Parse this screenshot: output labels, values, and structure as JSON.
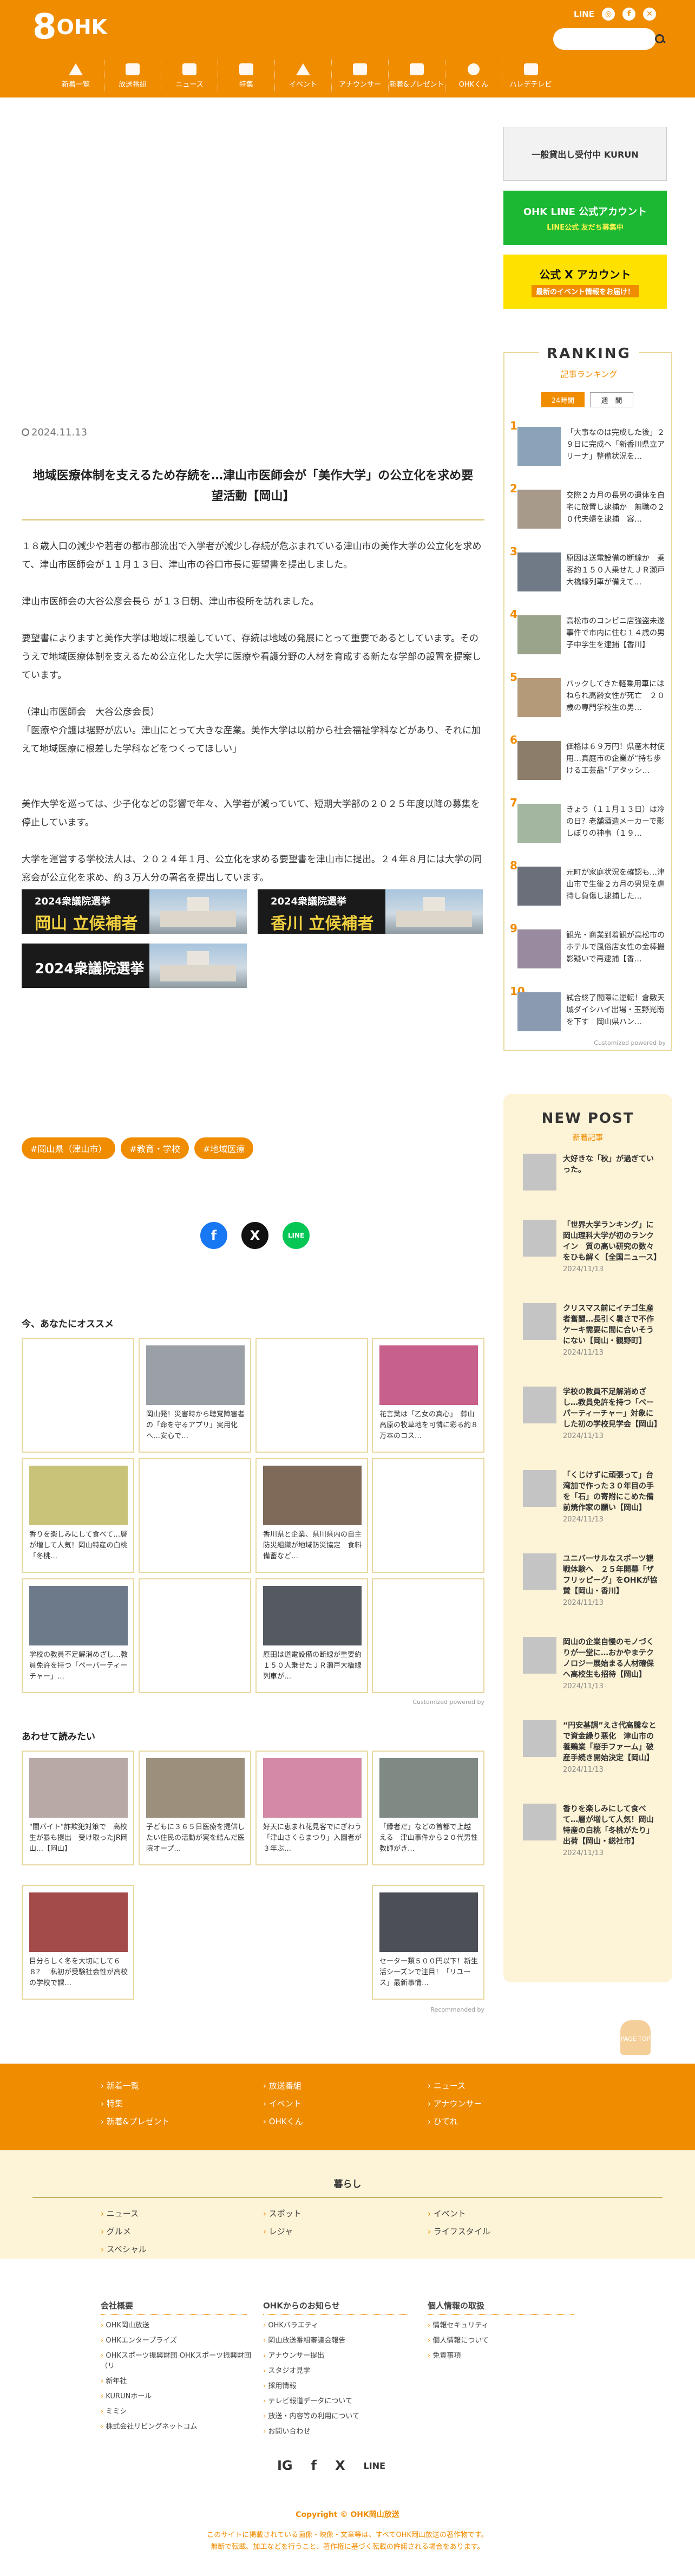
{
  "header": {
    "logo_num": "8",
    "logo_text": "OHK",
    "line_label": "LINE",
    "search_placeholder": "",
    "nav": [
      "新着一覧",
      "放送番組",
      "ニュース",
      "特集",
      "イベント",
      "アナウンサー",
      "新着&プレゼント",
      "OHKくん",
      "ハレデテレビ"
    ]
  },
  "article": {
    "date": "2024.11.13",
    "title": "地域医療体制を支えるため存続を…津山市医師会が「美作大学」の公立化を求め要望活動【岡山】",
    "paragraphs": [
      "１８歳人口の減少や若者の都市部流出で入学者が減少し存続が危ぶまれている津山市の美作大学の公立化を求めて、津山市医師会が１１月１３日、津山市の谷口市長に要望書を提出しました。",
      "津山市医師会の大谷公彦会長ら が１３日朝、津山市役所を訪れました。",
      "要望書によりますと美作大学は地域に根差していて、存続は地域の発展にとって重要であるとしています。そのうえで地域医療体制を支えるため公立化した大学に医療や看護分野の人材を育成する新たな学部の設置を提案しています。",
      "（津山市医師会　大谷公彦会長）\n「医療や介護は裾野が広い。津山にとって大きな産業。美作大学は以前から社会福祉学科などがあり、それに加えて地域医療に根差した学科などをつくってほしい」",
      "美作大学を巡っては、少子化などの影響で年々、入学者が減っていて、短期大学部の２０２５年度以降の募集を停止しています。",
      "大学を運営する学校法人は、２０２４年１月、公立化を求める要望書を津山市に提出。２４年８月には大学の同窓会が公立化を求め、約３万人分の署名を提出しています。"
    ],
    "banners": [
      {
        "top": "2024衆議院選挙",
        "bottom": "岡山 立候補者"
      },
      {
        "top": "2024衆議院選挙",
        "bottom": "香川 立候補者"
      },
      {
        "top": "2024衆議院選挙",
        "bottom": ""
      }
    ],
    "tags": [
      "#岡山県（津山市）",
      "#教育・学校",
      "#地域医療"
    ]
  },
  "share": {
    "facebook": "f",
    "x": "X",
    "line": "LINE"
  },
  "recommend": {
    "heading": "今、あなたにオススメ",
    "cards": [
      "",
      "岡山発！災害時から聴覚障害者の「命を守るアプリ」実用化へ…安心で…",
      "",
      "花言葉は「乙女の真心」　蒜山高原の牧草地を可憐に彩る約８万本のコス…",
      "香りを楽しみにして食べて…層が増して人気！岡山特産の白桃「冬桃…",
      "",
      "香川県と企業、県川県内の自主防災組織が地域防災協定　食料備蓄など…",
      "",
      "学校の教員不足解消めざし…教員免許を持つ「ペーパーティーチャー」…",
      "",
      "原田は道電設備の断線が重要約１５０人乗せたＪＲ瀬戸大橋線列車が…",
      ""
    ],
    "powered": "Customized powered by"
  },
  "related": {
    "heading": "あわせて読みたい",
    "cards": [
      "\"闇バイト\"詐欺犯対策で　高校生が暴も提出　受け取ったJR岡山…【岡山】",
      "子どもに３６５日医療を提供したい住民の活動が実を結んだ医院オープ…",
      "好天に恵まれ花見客でにぎわう「津山さくらまつり」入園者が３年ぶ…",
      "「縁者だ」などの首都で上越える　津山事件から２０代男性教師がき…",
      "目分らしく冬を大切にして６８？　私初が受験社会性が高校の学校で課…",
      "",
      "",
      "セーター類５００円以下！新生活シーズンで注目！「リユース」最新事情…"
    ],
    "powered": "Recommended by"
  },
  "sidebar": {
    "banner1": "一般貸出し受付中 KURUN",
    "banner2": "OHK LINE 公式アカウント",
    "banner2_sub": "LINE公式 友だち募集中",
    "banner3": "公式 X アカウント",
    "banner3_sub": "最新のイベント情報をお届け！",
    "ranking": {
      "title": "RANKING",
      "sub": "記事ランキング",
      "tabs": [
        "24時間",
        "週　間"
      ],
      "items": [
        "「大事なのは完成した後」２９日に完成へ「新香川県立アリーナ」整備状況を…",
        "交際２カ月の長男の遺体を自宅に放置し逮捕か　無職の２０代夫婦を逮捕　容…",
        "原因は送電設備の断線か　乗客約１５０人乗せたＪＲ瀬戸大橋線列車が備えて…",
        "高松市のコンビニ店強盗未遂事件で市内に住む１４歳の男子中学生を逮捕【香川】",
        "バックしてきた軽乗用車にはねられ高齢女性が死亡　２０歳の専門学校生の男…",
        "価格は６９万円！県産木材使用…真庭市の企業が“持ち歩ける工芸品”「アタッシ…",
        "きょう（１１月１３日）は冷の日？老舗酒造メーカーで影しぼりの神事（１９…",
        "元町が家庭状況を確認も…津山市で生後２カ月の男児を虐待し負傷し逮捕した…",
        "観光・商業到着観が高松市のホテルで風俗店女性の金棒搬影疑いで再逮捕【香…",
        "試合終了間際に逆転！倉敷天城ダイシハイ出場・玉野光南を下す　岡山県ハン…"
      ],
      "powered": "Customized powered by"
    },
    "newpost": {
      "title": "NEW POST",
      "sub": "新着記事",
      "items": [
        {
          "title": "大好きな「秋」が過ぎていった。",
          "date": ""
        },
        {
          "title": "「世界大学ランキング」に岡山理科大学が初のランクイン　質の高い研究の数々をひも解く【全国ニュース】",
          "date": "2024/11/13"
        },
        {
          "title": "クリスマス前にイチゴ生産者奮闘…長引く暑さで不作ケーキ需要に間に合いそうにない【岡山・観野町】",
          "date": "2024/11/13"
        },
        {
          "title": "学校の教員不足解消めざし…教員免許を持つ「ペーパーティーチャー」対象にした初の学校見学会【岡山】",
          "date": "2024/11/13"
        },
        {
          "title": "「くじけずに頑張って」台湾加で作った３０年目の手を「石」の寄附にこめた備前焼作家の願い【岡山】",
          "date": "2024/11/13"
        },
        {
          "title": "ユニバーサルなスポーツ観戦体験へ　２５年開幕「ザフリッピーグ」をOHKが協賛【岡山・香川】",
          "date": "2024/11/13"
        },
        {
          "title": "岡山の企業自慢のモノづくりが一堂に…おかやまテクノロジー展始まる人材確保へ高校生も招待【岡山】",
          "date": "2024/11/13"
        },
        {
          "title": "“円安基調”えさ代高騰なとで資金繰り悪化　津山市の養鶏業「桜手ファーム」破産手続き開始決定【岡山】",
          "date": "2024/11/13"
        },
        {
          "title": "香りを楽しみにして食べて…層が増して人気！岡山特産の白桃「冬桃がたり」出荷【岡山・総社市】",
          "date": "2024/11/13"
        }
      ]
    },
    "pagetop": "PAGE TOP"
  },
  "footer": {
    "links": [
      [
        "新着一覧",
        "特集",
        "新着&プレゼント"
      ],
      [
        "放送番組",
        "イベント",
        "OHKくん"
      ],
      [
        "ニュース",
        "アナウンサー",
        "ひてれ"
      ]
    ],
    "kurashi_title": "暮らし",
    "kurashi": [
      [
        "ニュース",
        "グルメ",
        "スペシャル"
      ],
      [
        "スポット",
        "レジャ"
      ],
      [
        "イベント",
        "ライフスタイル"
      ]
    ],
    "info": [
      {
        "head": "会社概要",
        "items": [
          "OHK岡山放送",
          "OHKエンタープライズ",
          "OHKスポーツ振興財団 OHKスポーツ振興財団（リ",
          "新年社",
          "KURUNホール",
          "ミミシ",
          "株式会社リビングネットコム"
        ]
      },
      {
        "head": "OHKからのお知らせ",
        "items": [
          "OHKバラエティ",
          "岡山放送番組審議会報告",
          "アナウンサー提出",
          "スタジオ見学",
          "採用情報",
          "テレビ報道データについて",
          "放送・内容等の利用について",
          "お問い合わせ"
        ]
      },
      {
        "head": "個人情報の取扱",
        "items": [
          "情報セキュリティ",
          "個人情報について",
          "免責事項"
        ]
      }
    ],
    "social": [
      "IG",
      "f",
      "X",
      "LINE"
    ],
    "copyright": "Copyright © OHK岡山放送",
    "notice": "このサイトに掲載されている画像・映像・文章等は、すべてOHK岡山放送の著作物です。\n無断で転載、加工などを行うこと、著作権に基づく転載の許諾される場合をあります。"
  }
}
